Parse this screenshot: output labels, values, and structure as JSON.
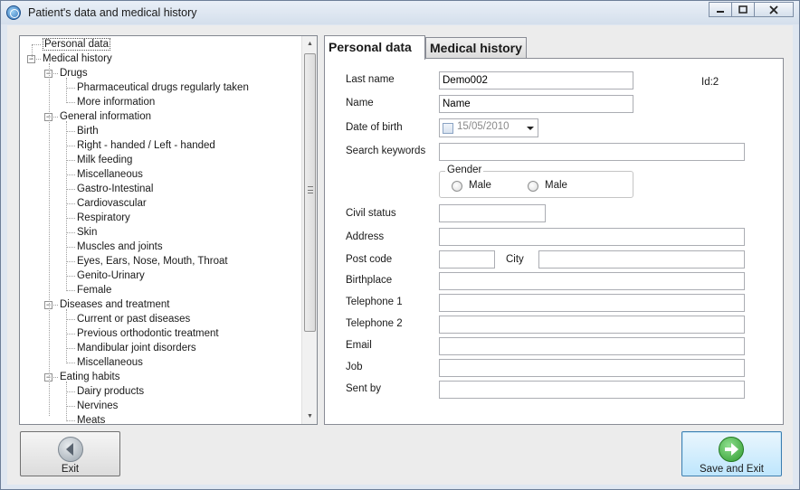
{
  "window": {
    "title": "Patient's data and medical history"
  },
  "tree": {
    "items": [
      {
        "label": "Personal data",
        "level": 0
      },
      {
        "label": "Medical history",
        "level": 0
      },
      {
        "label": "Drugs",
        "level": 1
      },
      {
        "label": "Pharmaceutical drugs regularly taken",
        "level": 2
      },
      {
        "label": "More information",
        "level": 2
      },
      {
        "label": "General information",
        "level": 1
      },
      {
        "label": "Birth",
        "level": 2
      },
      {
        "label": "Right - handed / Left - handed",
        "level": 2
      },
      {
        "label": "Milk feeding",
        "level": 2
      },
      {
        "label": "Miscellaneous",
        "level": 2
      },
      {
        "label": "Gastro-Intestinal",
        "level": 2
      },
      {
        "label": "Cardiovascular",
        "level": 2
      },
      {
        "label": "Respiratory",
        "level": 2
      },
      {
        "label": "Skin",
        "level": 2
      },
      {
        "label": "Muscles and joints",
        "level": 2
      },
      {
        "label": "Eyes, Ears, Nose, Mouth, Throat",
        "level": 2
      },
      {
        "label": "Genito-Urinary",
        "level": 2
      },
      {
        "label": "Female",
        "level": 2
      },
      {
        "label": "Diseases and treatment",
        "level": 1
      },
      {
        "label": "Current or past diseases",
        "level": 2
      },
      {
        "label": "Previous orthodontic treatment",
        "level": 2
      },
      {
        "label": "Mandibular joint disorders",
        "level": 2
      },
      {
        "label": "Miscellaneous",
        "level": 2
      },
      {
        "label": "Eating habits",
        "level": 1
      },
      {
        "label": "Dairy products",
        "level": 2
      },
      {
        "label": "Nervines",
        "level": 2
      },
      {
        "label": "Meats",
        "level": 2
      }
    ]
  },
  "tabs": {
    "personal": "Personal data",
    "medical": "Medical history"
  },
  "form": {
    "last_name_label": "Last name",
    "last_name_value": "Demo002",
    "name_label": "Name",
    "name_value": "Name",
    "dob_label": "Date of birth",
    "dob_value": "15/05/2010",
    "keywords_label": "Search keywords",
    "id_text": "Id:2",
    "gender_label": "Gender",
    "gender_option1": "Male",
    "gender_option2": "Male",
    "civil_label": "Civil status",
    "address_label": "Address",
    "postcode_label": "Post code",
    "city_label": "City",
    "birthplace_label": "Birthplace",
    "tel1_label": "Telephone 1",
    "tel2_label": "Telephone 2",
    "email_label": "Email",
    "job_label": "Job",
    "sentby_label": "Sent by"
  },
  "buttons": {
    "exit": "Exit",
    "save_exit": "Save and Exit"
  },
  "colors": {
    "save_icon": "#3aa53a",
    "exit_icon": "#9aa4ad"
  }
}
